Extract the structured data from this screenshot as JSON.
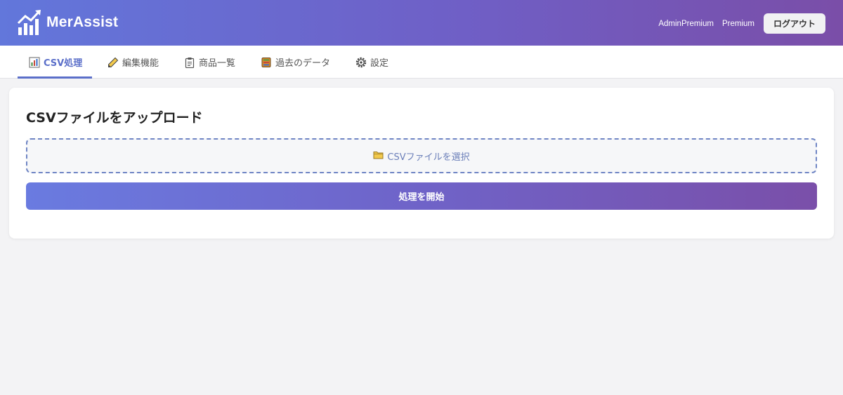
{
  "header": {
    "brand_name": "MerAssist",
    "logo_icon": "chart-bars-logo-icon",
    "user_name": "AdminPremium",
    "plan": "Premium",
    "logout_label": "ログアウト"
  },
  "tabs": [
    {
      "label": "CSV処理",
      "icon": "bar-chart-icon",
      "active": true
    },
    {
      "label": "編集機能",
      "icon": "pencil-icon",
      "active": false
    },
    {
      "label": "商品一覧",
      "icon": "clipboard-icon",
      "active": false
    },
    {
      "label": "過去のデータ",
      "icon": "ledger-icon",
      "active": false
    },
    {
      "label": "設定",
      "icon": "gear-icon",
      "active": false
    }
  ],
  "upload": {
    "title": "CSVファイルをアップロード",
    "file_select_label": "CSVファイルを選択",
    "file_select_icon": "folder-icon",
    "start_label": "処理を開始"
  },
  "colors": {
    "header_gradient_start": "#6277db",
    "header_gradient_end": "#7a4ea8",
    "accent": "#5b6fc9"
  }
}
